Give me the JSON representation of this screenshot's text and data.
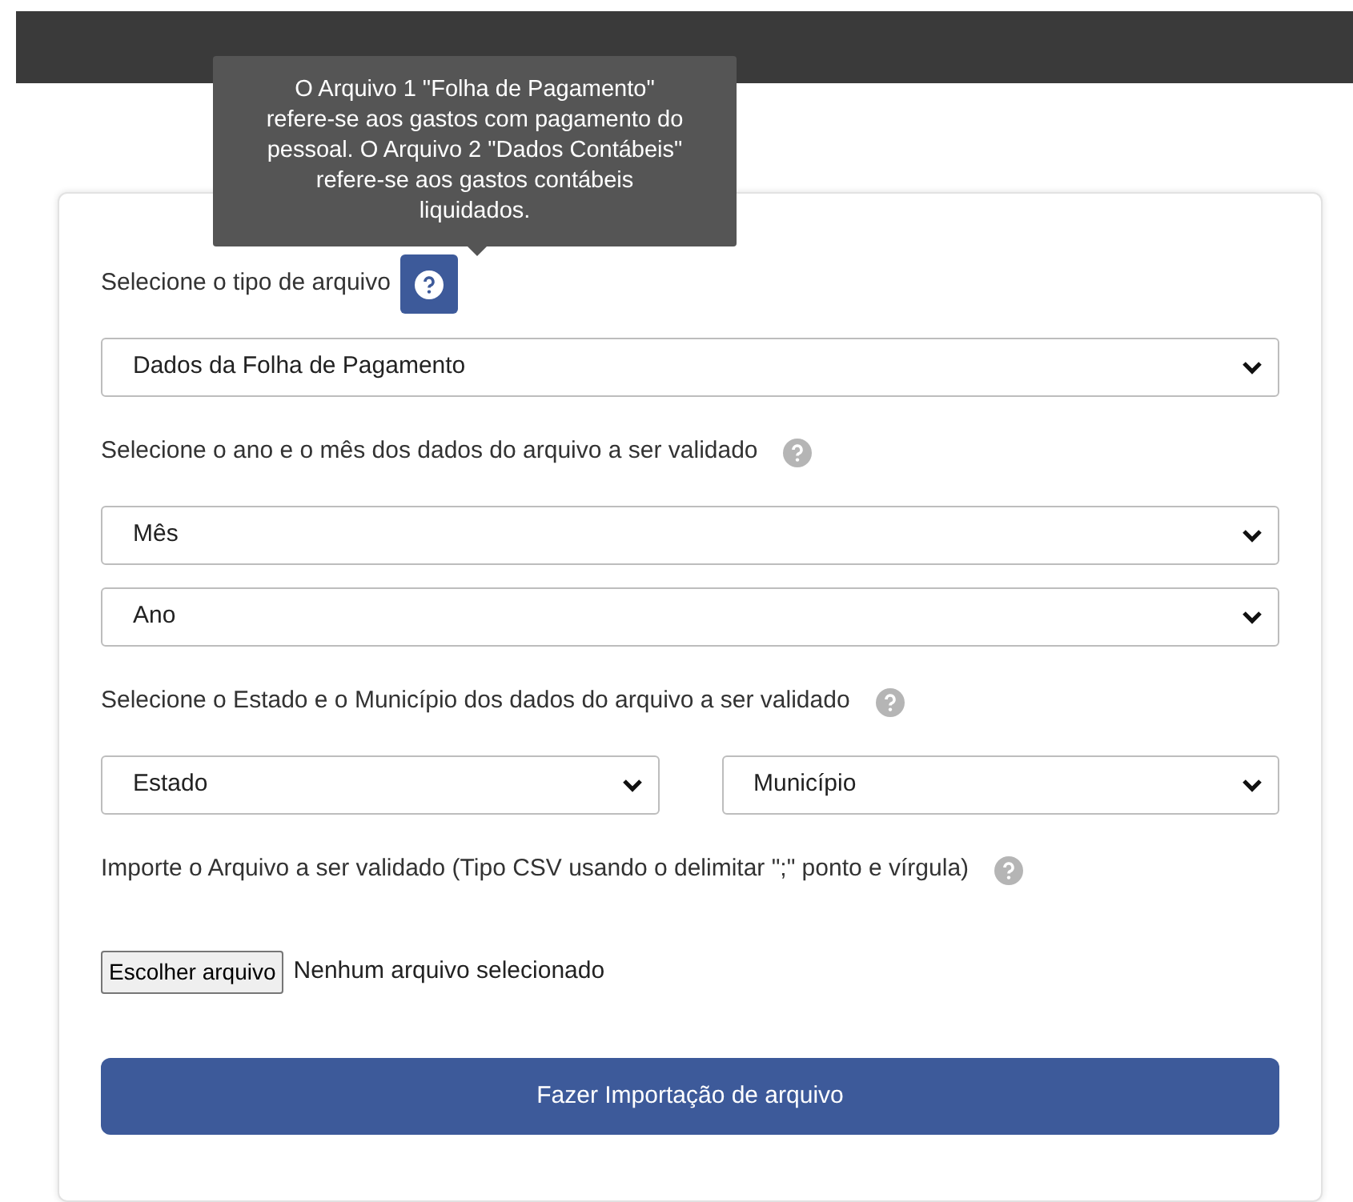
{
  "tooltip": {
    "text": "O Arquivo 1 \"Folha de Pagamento\" refere-se aos gastos com pagamento do pessoal. O Arquivo 2 \"Dados Contábeis\" refere-se aos gastos contábeis liquidados."
  },
  "sections": [
    {
      "label": "Selecione o tipo de arquivo",
      "help_active": true,
      "selects": [
        "Dados da Folha de Pagamento"
      ],
      "kind": "stack"
    },
    {
      "label": "Selecione o ano e o mês dos dados do arquivo a ser validado",
      "help_active": false,
      "selects": [
        "Mês",
        "Ano"
      ],
      "kind": "stack"
    },
    {
      "label": "Selecione o Estado e o Município dos dados do arquivo a ser validado",
      "help_active": false,
      "selects": [
        "Estado",
        "Município"
      ],
      "kind": "row"
    },
    {
      "label": "Importe o Arquivo a ser validado (Tipo CSV usando o delimitar \";\" ponto e vírgula)",
      "help_active": false,
      "kind": "stack"
    }
  ],
  "file_input": {
    "button": "Escolher arquivo",
    "status": "Nenhum arquivo selecionado"
  },
  "submit": "Fazer Importação de arquivo"
}
